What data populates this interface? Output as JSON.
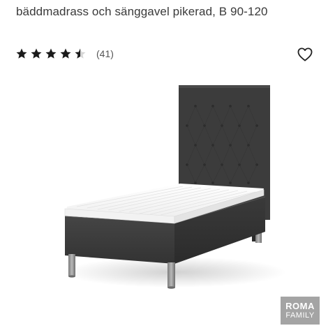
{
  "product": {
    "subtitle": "bäddmadrass och sänggavel pikerad, B 90-120"
  },
  "rating": {
    "value": 4.5,
    "max": 5,
    "count_label": "(41)"
  },
  "favorite": {
    "icon": "heart-outline-icon"
  },
  "image": {
    "alt": "Single bed with tufted dark grey headboard and mattress topper"
  },
  "brand": {
    "line1": "ROMA",
    "line2": "FAMILY"
  },
  "colors": {
    "star": "#1a1a1a",
    "upholstery": "#3b3b3b",
    "badge": "#a4a4a4"
  }
}
